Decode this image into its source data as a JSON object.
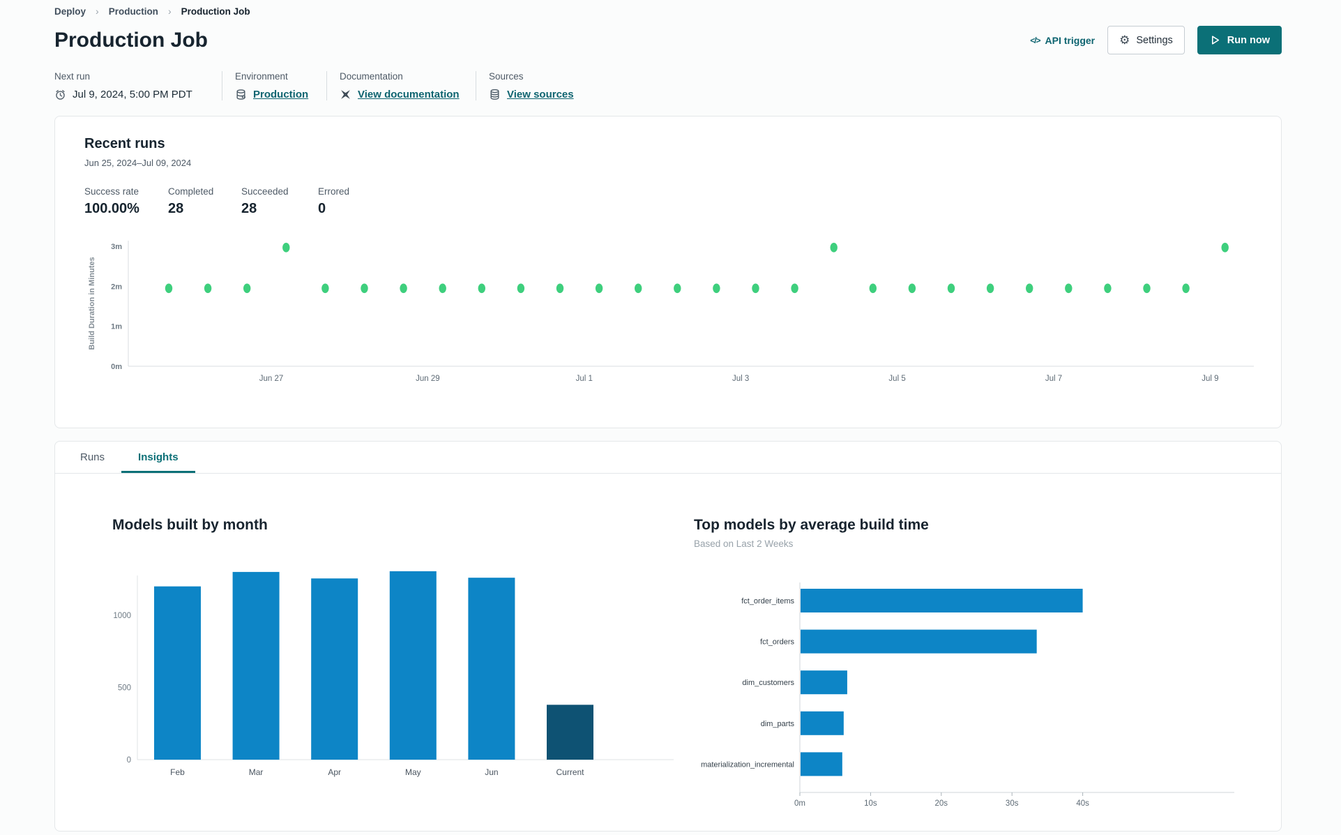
{
  "breadcrumb": {
    "items": [
      "Deploy",
      "Production",
      "Production Job"
    ]
  },
  "header": {
    "title": "Production Job",
    "api_trigger_label": "API trigger",
    "settings_label": "Settings",
    "run_now_label": "Run now"
  },
  "info_bar": {
    "next_run": {
      "label": "Next run",
      "value": "Jul 9, 2024, 5:00 PM PDT"
    },
    "environment": {
      "label": "Environment",
      "link": "Production"
    },
    "documentation": {
      "label": "Documentation",
      "link": "View documentation"
    },
    "sources": {
      "label": "Sources",
      "link": "View sources"
    }
  },
  "recent_runs": {
    "title": "Recent runs",
    "date_range": "Jun 25, 2024–Jul 09, 2024",
    "stats": [
      {
        "label": "Success rate",
        "value": "100.00%"
      },
      {
        "label": "Completed",
        "value": "28"
      },
      {
        "label": "Succeeded",
        "value": "28"
      },
      {
        "label": "Errored",
        "value": "0"
      }
    ]
  },
  "tabs": [
    {
      "label": "Runs",
      "active": false
    },
    {
      "label": "Insights",
      "active": true
    }
  ],
  "icons": {
    "api_trigger": "code-icon </>",
    "settings": "gear-icon ⚙",
    "run_now": "play-icon",
    "next_run": "alarm-clock-icon",
    "environment": "database-icon",
    "documentation": "dbt-docs-icon",
    "sources": "database-stack-icon",
    "breadcrumb_separator": "chevron-right-icon ›"
  },
  "colors": {
    "teal_button": "#0b7077",
    "teal_link": "#0e6470",
    "active_tab": "#0c7077",
    "run_dot_green": "#3ecf7d",
    "bar_blue": "#0d85c6",
    "bar_dark_blue": "#0e5273",
    "card_border": "#e4e7e9",
    "page_background": "#fbfcfc"
  },
  "chart_data": [
    {
      "id": "run-durations",
      "type": "scatter",
      "context": "Recent runs build durations, twice-daily job runs",
      "ylabel": "Build Duration in Minutes",
      "point_color": "#3ecf7d",
      "ylim": [
        0,
        3.3
      ],
      "y_ticks": [
        {
          "label": "0m",
          "minutes": 0
        },
        {
          "label": "1m",
          "minutes": 1
        },
        {
          "label": "2m",
          "minutes": 2
        },
        {
          "label": "3m",
          "minutes": 3
        }
      ],
      "x_ticks": [
        {
          "label": "Jun 27",
          "run_index": 2.62
        },
        {
          "label": "Jun 29",
          "run_index": 6.62
        },
        {
          "label": "Jul 1",
          "run_index": 10.62
        },
        {
          "label": "Jul 3",
          "run_index": 14.62
        },
        {
          "label": "Jul 5",
          "run_index": 18.62
        },
        {
          "label": "Jul 7",
          "run_index": 22.62
        },
        {
          "label": "Jul 9",
          "run_index": 26.62
        }
      ],
      "durations_minutes": [
        1.95,
        1.95,
        1.95,
        2.97,
        1.95,
        1.95,
        1.95,
        1.95,
        1.95,
        1.95,
        1.95,
        1.95,
        1.95,
        1.95,
        1.95,
        1.95,
        1.95,
        2.97,
        1.95,
        1.95,
        1.95,
        1.95,
        1.95,
        1.95,
        1.95,
        1.95,
        1.95,
        2.97
      ]
    },
    {
      "id": "models-by-month",
      "type": "bar",
      "title": "Models built by month",
      "categories": [
        "Feb",
        "Mar",
        "Apr",
        "May",
        "Jun",
        "Current"
      ],
      "values": [
        1200,
        1300,
        1255,
        1305,
        1260,
        380
      ],
      "y_ticks": [
        0,
        500,
        1000
      ],
      "ylim": [
        0,
        1350
      ],
      "bar_color": "#0d85c6",
      "highlight_index": 5,
      "highlight_color": "#0e5273"
    },
    {
      "id": "top-models-by-build-time",
      "type": "hbar",
      "title": "Top models by average build time",
      "subtitle": "Based on Last 2 Weeks",
      "categories": [
        "fct_order_items",
        "fct_orders",
        "dim_customers",
        "dim_parts",
        "materialization_incremental"
      ],
      "values_seconds": [
        39.9,
        33.4,
        6.6,
        6.1,
        5.9
      ],
      "x_ticks": [
        {
          "label": "0m",
          "seconds": 0
        },
        {
          "label": "10s",
          "seconds": 10
        },
        {
          "label": "20s",
          "seconds": 20
        },
        {
          "label": "30s",
          "seconds": 30
        },
        {
          "label": "40s",
          "seconds": 40
        }
      ],
      "xlim": [
        0,
        44
      ],
      "bar_color": "#0d85c6"
    }
  ]
}
